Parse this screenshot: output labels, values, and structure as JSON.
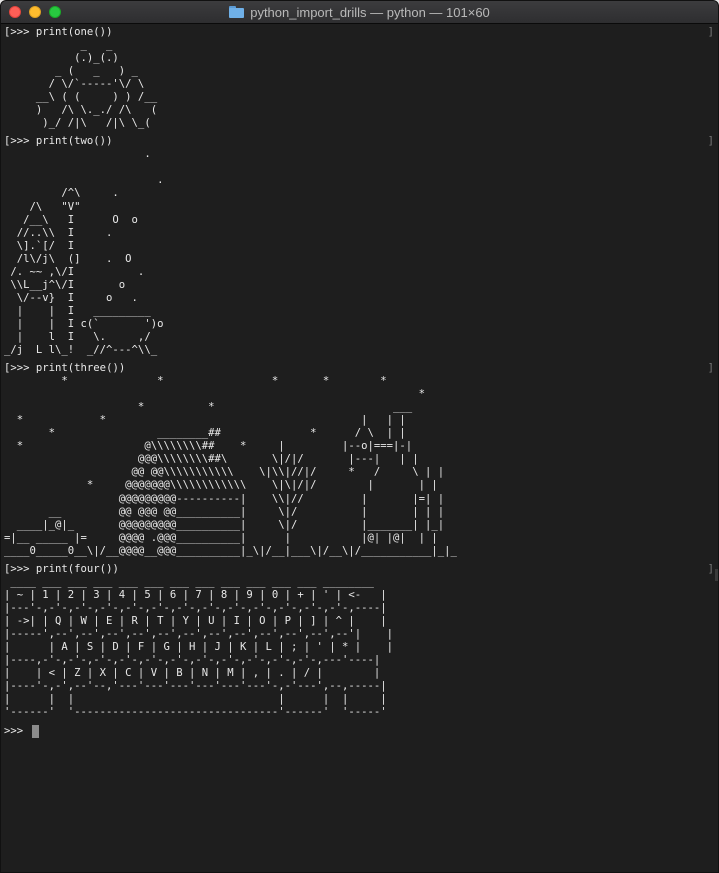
{
  "window": {
    "title": "python_import_drills — python — 101×60",
    "icon": "folder-icon"
  },
  "terminal": {
    "prompt": ">>> ",
    "bracket": "[",
    "right_bracket": "]",
    "blocks": [
      {
        "command": "print(one())",
        "output": "            _   _\n           (.)_(.)\n        _ (   _   ) _\n       / \\/`-----'\\/ \\\n     __\\ ( (     ) ) /__\n     )   /\\ \\._./ /\\   (\n      )_/ /|\\   /|\\ \\_("
      },
      {
        "command": "print(two())",
        "output": "                      .\n\n                        .\n         /^\\     .\n    /\\   \"V\"\n   /__\\   I      O  o\n  //..\\\\  I     .\n  \\].`[/  I\n  /l\\/j\\  (]    .  O\n /. ~~ ,\\/I          .\n \\\\L__j^\\/I       o\n  \\/--v}  I     o   .\n  |    |  I   _________\n  |    |  I c(`       ')o\n  |    l  I   \\.     ,/\n_/j  L l\\_!  _//^---^\\\\_"
      },
      {
        "command": "print(three())",
        "output": "         *              *                 *       *        *\n                                                                 *\n                     *          *                            ___\n  *            *                                        |   | |\n       *                ________##              *      / \\  | |\n  *                   @\\\\\\\\\\\\\\\\##    *     |         |--o|===|-|\n                     @@@\\\\\\\\\\\\\\\\##\\       \\|/|/       |---|   | |\n                    @@ @@\\\\\\\\\\\\\\\\\\\\\\    \\|\\\\|//|/     *   /     \\ | |\n             *     @@@@@@@\\\\\\\\\\\\\\\\\\\\\\\\    \\|\\|/|/        |       | |\n                  @@@@@@@@@----------|    \\\\|//         |       |=| |\n       __         @@ @@@ @@__________|     \\|/          |       | | |\n  ____|_@|_       @@@@@@@@@__________|     \\|/          |_______| |_|\n=|__ _____ |=     @@@@ .@@@__________|      |           |@| |@|  | |\n____0_____0__\\|/__@@@@__@@@__________|_\\|/__|___\\|/__\\|/___________|_|_"
      },
      {
        "command": "print(four())",
        "output": " ____ ___ ___ ___ ___ ___ ___ ___ ___ ___ ___ ___ ________\n| ~ | 1 | 2 | 3 | 4 | 5 | 6 | 7 | 8 | 9 | 0 | + | ' | <-   |\n|---'-,-'-,-'-,-'-,-'-,-'-,-'-,-'-,-'-,-'-,-'-,-'-,-'-,----|\n| ->| | Q | W | E | R | T | Y | U | I | O | P | ] | ^ |    |\n|-----',--',--',--',--',--',--',--',--',--',--',--',--'|    |\n|      | A | S | D | F | G | H | J | K | L | ; | ' | * |    |\n|----,-'-,-'-,-'-,-'-,-'-,-'-,-'-,-'-,-'-,-'-,-'-,---'----|\n|    | < | Z | X | C | V | B | N | M | , | . | / |        |\n|----'-,-',--'--,'---'---'---'---'---'---'-,-'---',--,-----|\n|      |  |                                |      |  |     |\n'------'  '--------------------------------'------'  '-----'"
      }
    ]
  }
}
